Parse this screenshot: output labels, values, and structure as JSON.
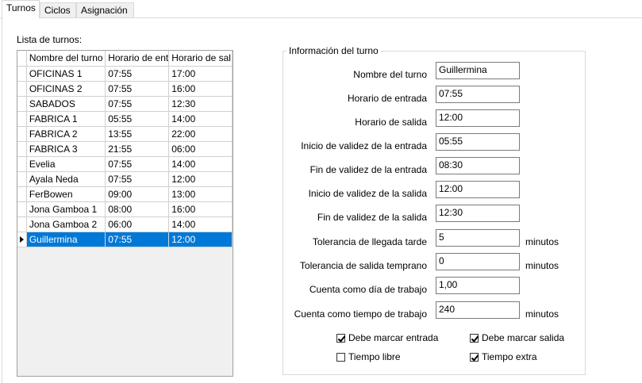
{
  "tabs": [
    "Turnos",
    "Ciclos",
    "Asignación"
  ],
  "list": {
    "label": "Lista de turnos:",
    "columns": [
      "Nombre del turno",
      "Horario de ent",
      "Horario de sal"
    ],
    "rows": [
      [
        "OFICINAS 1",
        "07:55",
        "17:00"
      ],
      [
        "OFICINAS 2",
        "07:55",
        "16:00"
      ],
      [
        "SABADOS",
        "07:55",
        "12:30"
      ],
      [
        "FABRICA 1",
        "05:55",
        "14:00"
      ],
      [
        "FABRICA 2",
        "13:55",
        "22:00"
      ],
      [
        "FABRICA 3",
        "21:55",
        "06:00"
      ],
      [
        "Evelia",
        "07:55",
        "14:00"
      ],
      [
        "Ayala Neda",
        "07:55",
        "12:00"
      ],
      [
        "FerBowen",
        "09:00",
        "13:00"
      ],
      [
        "Jona Gamboa 1",
        "08:00",
        "16:00"
      ],
      [
        "Jona Gamboa 2",
        "06:00",
        "14:00"
      ],
      [
        "Guillermina",
        "07:55",
        "12:00"
      ]
    ],
    "selected_index": 11
  },
  "info": {
    "title": "Información del turno",
    "fields": [
      {
        "label": "Nombre del turno",
        "value": "Guillermina"
      },
      {
        "label": "Horario de entrada",
        "value": "07:55"
      },
      {
        "label": "Horario de salida",
        "value": "12:00"
      },
      {
        "label": "Inicio de validez de la entrada",
        "value": "05:55"
      },
      {
        "label": "Fin de validez de la entrada",
        "value": "08:30"
      },
      {
        "label": "Inicio de validez de la salida",
        "value": "12:00"
      },
      {
        "label": "Fin de validez de la salida",
        "value": "12:30"
      },
      {
        "label": "Tolerancia de llegada tarde",
        "value": "5",
        "unit": "minutos"
      },
      {
        "label": "Tolerancia de salida temprano",
        "value": "0",
        "unit": "minutos"
      },
      {
        "label": "Cuenta como día de trabajo",
        "value": "1,00"
      },
      {
        "label": "Cuenta como tiempo de trabajo",
        "value": "240",
        "unit": "minutos"
      }
    ],
    "checkboxes": [
      {
        "label": "Debe marcar entrada",
        "checked": true
      },
      {
        "label": "Debe marcar salida",
        "checked": true
      },
      {
        "label": "Tiempo libre",
        "checked": false
      },
      {
        "label": "Tiempo extra",
        "checked": true
      }
    ]
  },
  "colors": {
    "selection": "#0078d7",
    "border": "#d9d9d9"
  }
}
